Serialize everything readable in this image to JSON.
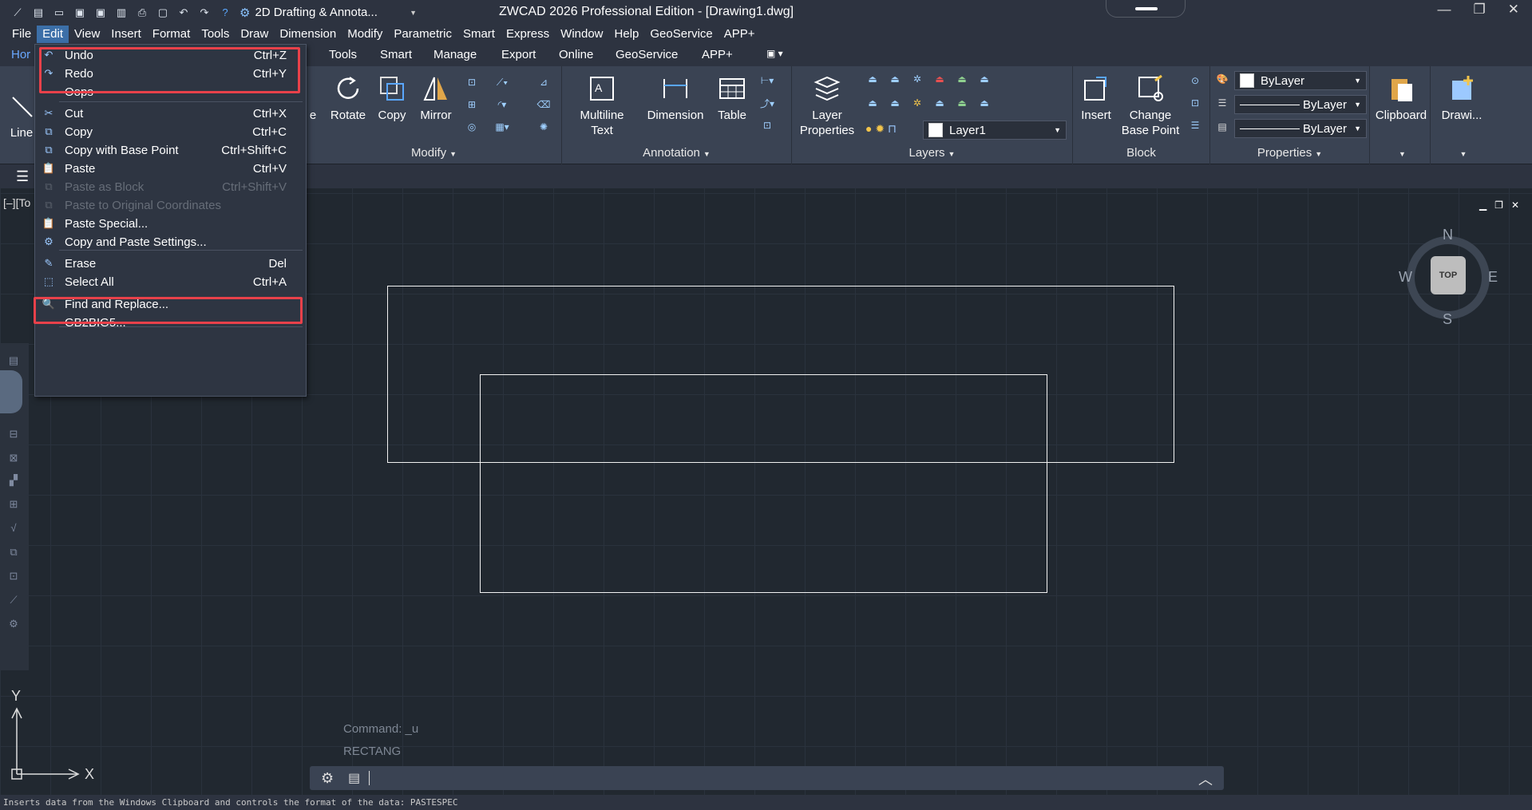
{
  "window": {
    "title": "ZWCAD 2026 Professional Edition - [Drawing1.dwg]",
    "workspace": "2D Drafting & Annota...",
    "minimize": "—",
    "maximize": "❐",
    "close": "✕"
  },
  "menus": [
    "File",
    "Edit",
    "View",
    "Insert",
    "Format",
    "Tools",
    "Draw",
    "Dimension",
    "Modify",
    "Parametric",
    "Smart",
    "Express",
    "Window",
    "Help",
    "GeoService",
    "APP+"
  ],
  "ribbon_tabs": [
    "Hor",
    "Tools",
    "Smart",
    "Manage",
    "Export",
    "Online",
    "GeoService",
    "APP+"
  ],
  "ribbon": {
    "line_label": "Line",
    "modify": {
      "title": "Modify",
      "e_label": "e",
      "rotate": "Rotate",
      "copy": "Copy",
      "mirror": "Mirror"
    },
    "annotation": {
      "title": "Annotation",
      "mtext": "Multiline\nText",
      "dimension": "Dimension",
      "table": "Table"
    },
    "layers": {
      "title": "Layers",
      "layer_props": "Layer\nProperties",
      "current_layer": "Layer1"
    },
    "block": {
      "title": "Block",
      "insert": "Insert",
      "change_base": "Change\nBase Point"
    },
    "properties": {
      "title": "Properties",
      "color": "ByLayer",
      "linetype": "ByLayer",
      "lineweight": "ByLayer"
    },
    "clipboard": "Clipboard",
    "drawing": "Drawi..."
  },
  "viewport_label": "[–][To",
  "edit_menu": [
    {
      "icon": "undo",
      "label": "Undo",
      "shortcut": "Ctrl+Z",
      "enabled": true
    },
    {
      "icon": "redo",
      "label": "Redo",
      "shortcut": "Ctrl+Y",
      "enabled": true
    },
    {
      "icon": "",
      "label": "Oops",
      "shortcut": "",
      "enabled": true
    },
    {
      "icon": "cut",
      "label": "Cut",
      "shortcut": "Ctrl+X",
      "enabled": true
    },
    {
      "icon": "copy",
      "label": "Copy",
      "shortcut": "Ctrl+C",
      "enabled": true
    },
    {
      "icon": "copybase",
      "label": "Copy with Base Point",
      "shortcut": "Ctrl+Shift+C",
      "enabled": true
    },
    {
      "icon": "paste",
      "label": "Paste",
      "shortcut": "Ctrl+V",
      "enabled": true
    },
    {
      "icon": "pasteblock",
      "label": "Paste as Block",
      "shortcut": "Ctrl+Shift+V",
      "enabled": false
    },
    {
      "icon": "pasteorig",
      "label": "Paste to Original Coordinates",
      "shortcut": "",
      "enabled": false
    },
    {
      "icon": "pastespecial",
      "label": "Paste Special...",
      "shortcut": "",
      "enabled": true
    },
    {
      "icon": "pastesettings",
      "label": "Copy and Paste Settings...",
      "shortcut": "",
      "enabled": true
    },
    {
      "icon": "erase",
      "label": "Erase",
      "shortcut": "Del",
      "enabled": true
    },
    {
      "icon": "selectall",
      "label": "Select All",
      "shortcut": "Ctrl+A",
      "enabled": true
    },
    {
      "icon": "find",
      "label": "Find and Replace...",
      "shortcut": "",
      "enabled": true
    },
    {
      "icon": "",
      "label": "GB2BIG5...",
      "shortcut": "",
      "enabled": true
    }
  ],
  "compass": {
    "n": "N",
    "s": "S",
    "e": "E",
    "w": "W",
    "top": "TOP"
  },
  "ucs": {
    "x": "X",
    "y": "Y"
  },
  "command_history": [
    "Command: _u",
    "RECTANG"
  ],
  "status_text": "Inserts data from the Windows Clipboard and controls the format of the data: PASTESPEC",
  "colors": {
    "accent": "#3c6fa8",
    "highlight": "#e8414a"
  }
}
